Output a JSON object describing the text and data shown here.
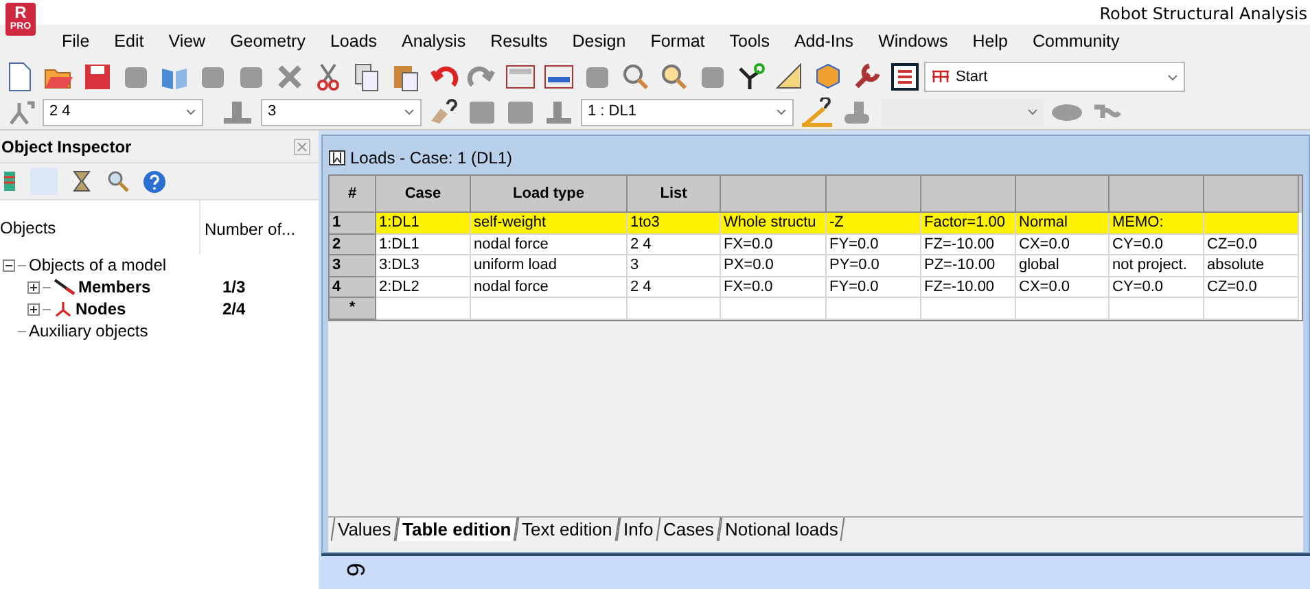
{
  "window": {
    "title": "Robot Structural Analysis"
  },
  "app_logo": {
    "letter": "R",
    "badge": "PRO"
  },
  "menu": [
    "File",
    "Edit",
    "View",
    "Geometry",
    "Loads",
    "Analysis",
    "Results",
    "Design",
    "Format",
    "Tools",
    "Add-Ins",
    "Windows",
    "Help",
    "Community"
  ],
  "toolbar": {
    "layout_combo": {
      "value": "Start"
    }
  },
  "selection_bar": {
    "bars_combo": {
      "value": "2 4"
    },
    "nodes_combo": {
      "value": "3"
    },
    "case_combo": {
      "value": "1 : DL1"
    }
  },
  "object_inspector": {
    "title": "Object Inspector",
    "columns": [
      "Objects",
      "Number of..."
    ],
    "tree": [
      {
        "label": "Objects of a model",
        "expanded": true,
        "children": [
          {
            "label": "Members",
            "count": "1/3",
            "emphasized": true,
            "expanded": false,
            "kind": "members"
          },
          {
            "label": "Nodes",
            "count": "2/4",
            "emphasized": true,
            "expanded": false,
            "kind": "nodes"
          }
        ]
      },
      {
        "label": "Auxiliary objects"
      }
    ]
  },
  "loads_window": {
    "title": "Loads - Case: 1 (DL1)",
    "table": {
      "columns": [
        "#",
        "Case",
        "Load type",
        "List"
      ],
      "rows": [
        {
          "number": "1",
          "highlighted": true,
          "cells": [
            "1:DL1",
            "self-weight",
            "1to3",
            "Whole structu",
            "-Z",
            "Factor=1.00",
            "Normal",
            "MEMO:"
          ]
        },
        {
          "number": "2",
          "highlighted": false,
          "cells": [
            "1:DL1",
            "nodal force",
            "2 4",
            "FX=0.0",
            "FY=0.0",
            "FZ=-10.00",
            "CX=0.0",
            "CY=0.0",
            "CZ=0.0"
          ]
        },
        {
          "number": "3",
          "highlighted": false,
          "cells": [
            "3:DL3",
            "uniform load",
            "3",
            "PX=0.0",
            "PY=0.0",
            "PZ=-10.00",
            "global",
            "not project.",
            "absolute"
          ]
        },
        {
          "number": "4",
          "highlighted": false,
          "cells": [
            "2:DL2",
            "nodal force",
            "2 4",
            "FX=0.0",
            "FY=0.0",
            "FZ=-10.00",
            "CX=0.0",
            "CY=0.0",
            "CZ=0.0"
          ]
        },
        {
          "number": "*",
          "highlighted": false,
          "cells": []
        }
      ]
    },
    "tabs": [
      {
        "label": "Values",
        "selected": false
      },
      {
        "label": "Table edition",
        "selected": true
      },
      {
        "label": "Text edition",
        "selected": false
      },
      {
        "label": "Info",
        "selected": false
      },
      {
        "label": "Cases",
        "selected": false
      },
      {
        "label": "Notional loads",
        "selected": false
      }
    ]
  },
  "canvas_label": "6"
}
